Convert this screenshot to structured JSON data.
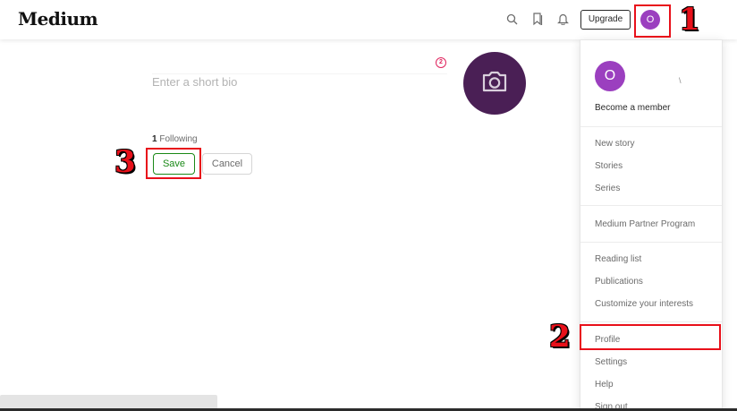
{
  "header": {
    "logo": "Medium",
    "icons": [
      "search-icon",
      "bookmark-icon",
      "bell-icon"
    ],
    "upgrade_label": "Upgrade",
    "avatar_initial": "O"
  },
  "profile_editor": {
    "bio_placeholder": "Enter a short bio",
    "photo_marker": "2",
    "photo_icon": "camera-icon",
    "following_count": "1",
    "following_label": "Following",
    "save_label": "Save",
    "cancel_label": "Cancel"
  },
  "menu": {
    "avatar_initial": "O",
    "caret": "\\",
    "become_member": "Become a member",
    "items_group1": [
      "New story",
      "Stories",
      "Series"
    ],
    "items_group2": [
      "Medium Partner Program"
    ],
    "items_group3": [
      "Reading list",
      "Publications",
      "Customize your interests"
    ],
    "items_group4": [
      "Profile",
      "Settings",
      "Help",
      "Sign out"
    ]
  },
  "annotations": {
    "step1": "1",
    "step2": "2",
    "step3": "3"
  },
  "colors": {
    "avatar": "#9b3fbf",
    "photo": "#4a1f55",
    "save_green": "#1a8917",
    "annotation_red": "#e8101a"
  }
}
